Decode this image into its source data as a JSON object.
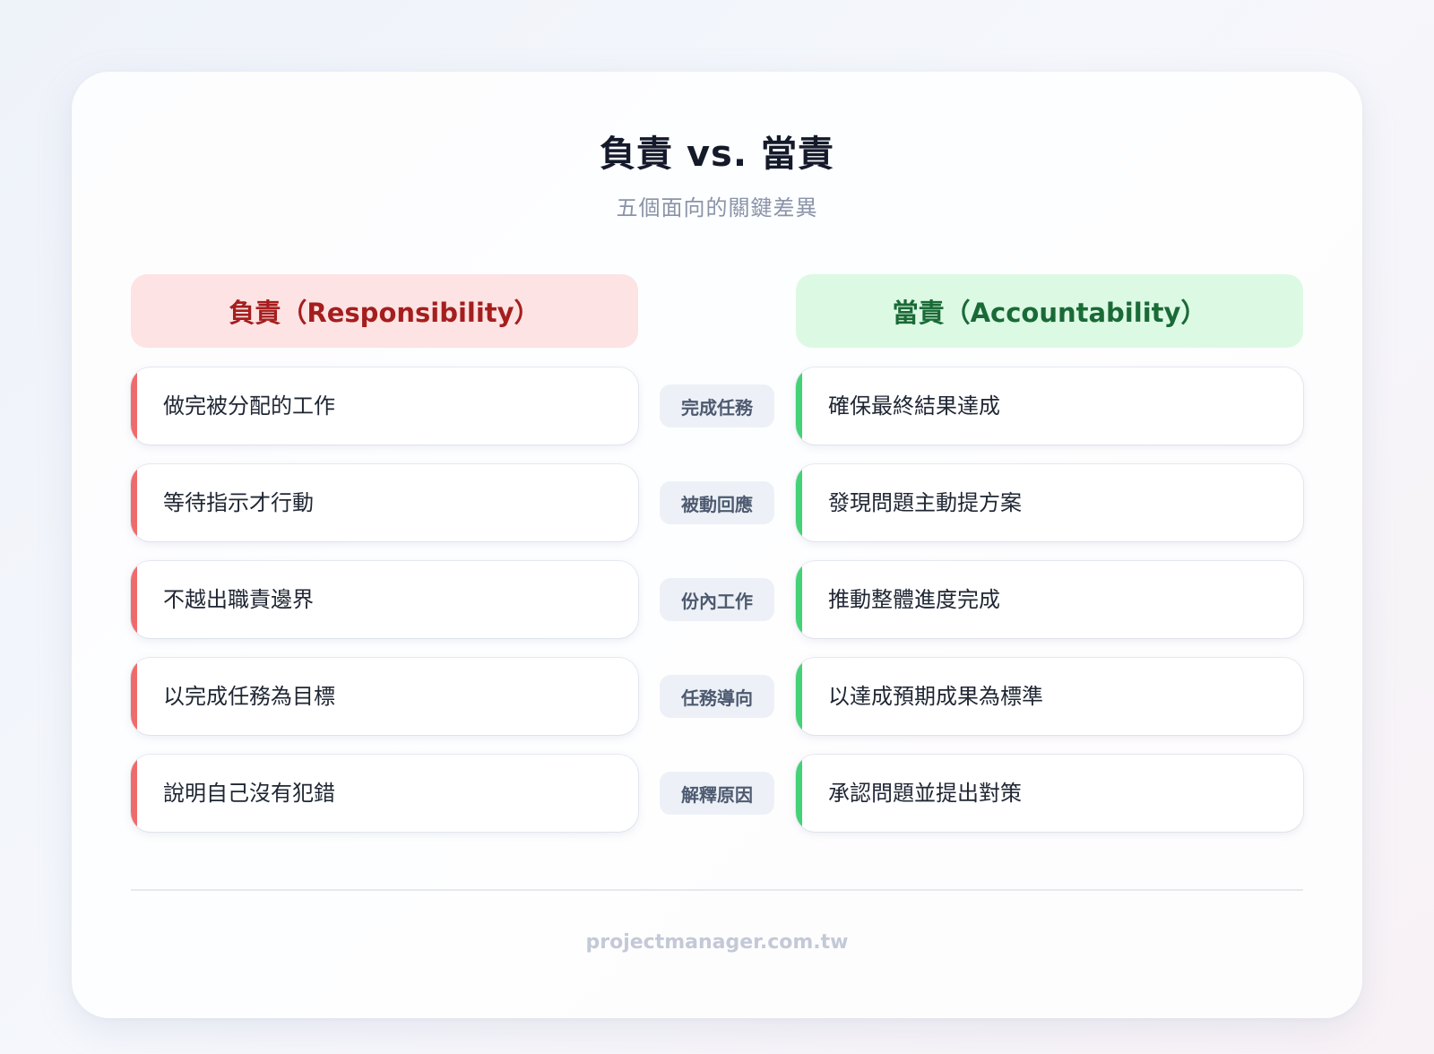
{
  "title": "負責 vs. 當責",
  "subtitle": "五個面向的關鍵差異",
  "left_header": "負責（Responsibility）",
  "right_header": "當責（Accountability）",
  "rows": [
    {
      "left": "做完被分配的工作",
      "badge": "完成任務",
      "right": "確保最終結果達成"
    },
    {
      "left": "等待指示才行動",
      "badge": "被動回應",
      "right": "發現問題主動提方案"
    },
    {
      "left": "不越出職責邊界",
      "badge": "份內工作",
      "right": "推動整體進度完成"
    },
    {
      "left": "以完成任務為目標",
      "badge": "任務導向",
      "right": "以達成預期成果為標準"
    },
    {
      "left": "說明自己沒有犯錯",
      "badge": "解釋原因",
      "right": "承認問題並提出對策"
    }
  ],
  "footer": "projectmanager.com.tw",
  "colors": {
    "responsibility_accent": "#ef6b6b",
    "responsibility_header_bg": "#fde3e3",
    "responsibility_header_text": "#a51e1e",
    "accountability_accent": "#43d276",
    "accountability_header_bg": "#dcf9e4",
    "accountability_header_text": "#1a6a36",
    "badge_bg": "#edf1f7"
  }
}
